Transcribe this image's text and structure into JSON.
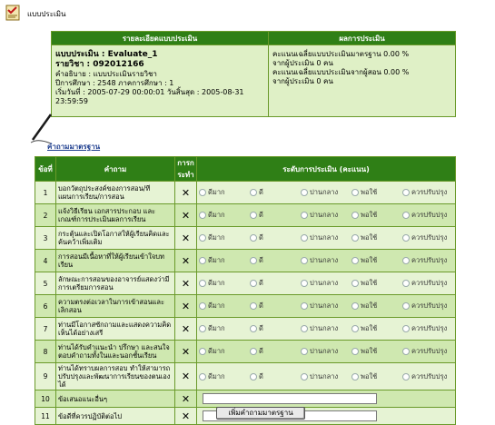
{
  "header": {
    "title": "แบบประเมิน"
  },
  "summary": {
    "left_header": "รายละเอียดแบบประเมิน",
    "right_header": "ผลการประเมิน",
    "eval_name": "แบบประเมิน : Evaluate_1",
    "course": "รายวิชา : 092012166",
    "description": "คำอธิบาย : แบบประเมินรายวิชา",
    "academic_year": "ปีการศึกษา : 2548 ภาคการศึกษา : 1",
    "period": "เริ่มวันที่ : 2005-07-29 00:00:01  วันสิ้นสุด : 2005-08-31 23:59:59",
    "result_line1": "คะแนนเฉลี่ยแบบประเมินมาตรฐาน 0.00 %",
    "result_line2": "จากผู้ประเมิน 0 คน",
    "result_line3": "คะแนนเฉลี่ยแบบประเมินจากผู้สอน 0.00 %",
    "result_line4": "จากผู้ประเมิน 0 คน"
  },
  "section": {
    "title": "คำถามมาตรฐาน"
  },
  "table": {
    "col_no": "ข้อที่",
    "col_question": "คำถาม",
    "col_action": "การกระทำ",
    "col_level": "ระดับการประเมิน (คะแนน)",
    "options": [
      "ดีมาก",
      "ดี",
      "ปานกลาง",
      "พอใช้",
      "ควรปรับปรุง"
    ],
    "rows": [
      {
        "no": "1",
        "q": "บอกวัตถุประสงค์ของการสอน/ทีแผนการเรียน/การสอน"
      },
      {
        "no": "2",
        "q": "แจ้งวิธีเรียน เอกสารประกอบ และเกณฑ์การประเมินผลการเรียน"
      },
      {
        "no": "3",
        "q": "กระตุ้นและเปิดโอกาสให้ผู้เรียนคิดและค้นคว้าเพิ่มเติม"
      },
      {
        "no": "4",
        "q": "การสอนมีเนื้อหาที่ให้ผู้เรียนเข้าใจบทเรียน"
      },
      {
        "no": "5",
        "q": "ลักษณะการสอนของอาจารย์แสดงว่ามีการเตรียมการสอน"
      },
      {
        "no": "6",
        "q": "ความตรงต่อเวลาในการเข้าสอนและเลิกสอน"
      },
      {
        "no": "7",
        "q": "ท่านมีโอกาสซักถามและแสดงความคิดเห็นได้อย่างเสรี"
      },
      {
        "no": "8",
        "q": "ท่านได้รับคำแนะนำ ปรึกษา และสนใจตอบคำถามทั้งในและนอกชั้นเรียน"
      },
      {
        "no": "9",
        "q": "ท่านได้ทราบผลการสอบ ทำให้สามารถปรับปรุงและพัฒนาการเรียนของตนเองได้"
      },
      {
        "no": "10",
        "q": "ข้อเสนอแนะอื่นๆ"
      },
      {
        "no": "11",
        "q": "ข้อดีที่ควรปฏิบัติต่อไป"
      }
    ],
    "delete_glyph": "✕"
  },
  "buttons": {
    "add_standard": "เพิ่มคำถามมาตรฐาน"
  }
}
